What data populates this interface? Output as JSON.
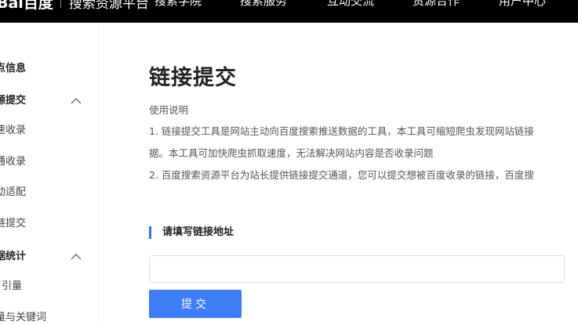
{
  "header": {
    "logo_text": "Bai百度",
    "platform_name": "搜索资源平台",
    "nav": [
      {
        "label": "搜索学院"
      },
      {
        "label": "搜索服务"
      },
      {
        "label": "互动交流"
      },
      {
        "label": "资源合作"
      },
      {
        "label": "用户中心"
      }
    ]
  },
  "sidebar": {
    "items": [
      {
        "label": "点信息",
        "kind": "group",
        "collapsible": false
      },
      {
        "label": "源提交",
        "kind": "group",
        "collapsible": true,
        "expanded": true
      },
      {
        "label": "速收录",
        "kind": "child"
      },
      {
        "label": "通收录",
        "kind": "child"
      },
      {
        "label": "动适配",
        "kind": "child"
      },
      {
        "label": "链提交",
        "kind": "child"
      },
      {
        "label": "据统计",
        "kind": "group",
        "collapsible": true,
        "expanded": true
      },
      {
        "label": "引量",
        "kind": "child"
      },
      {
        "label": "量与关键词",
        "kind": "child"
      }
    ],
    "chevron_icon": "chevron-up-icon"
  },
  "main": {
    "title": "链接提交",
    "instructions_heading": "使用说明",
    "instructions": [
      "1. 链接提交工具是网站主动向百度搜索推送数据的工具，本工具可缩短爬虫发现网站链接",
      "据。本工具可加快爬虫抓取速度，无法解决网站内容是否收录问题",
      "2. 百度搜索资源平台为站长提供链接提交通道，您可以提交想被百度收录的链接，百度搜"
    ],
    "form": {
      "section_title": "请填写链接地址",
      "url_value": "",
      "url_placeholder": "",
      "submit_label": "提交"
    }
  },
  "colors": {
    "topbar_bg": "#000000",
    "accent": "#3e7cf8",
    "section_marker": "#3b6ae8",
    "text_primary": "#222222",
    "text_secondary": "#555555"
  }
}
